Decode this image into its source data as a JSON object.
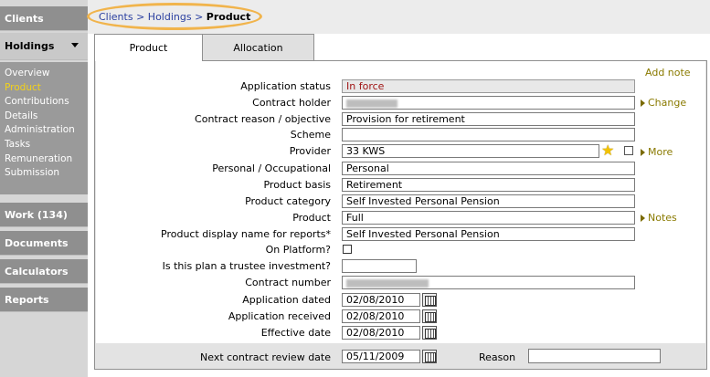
{
  "sidebar": {
    "clients": "Clients",
    "holdings": "Holdings",
    "subnav": [
      "Overview",
      "Product",
      "Contributions",
      "Details",
      "Administration",
      "Tasks",
      "Remuneration",
      "Submission"
    ],
    "work": "Work (134)",
    "documents": "Documents",
    "calculators": "Calculators",
    "reports": "Reports"
  },
  "breadcrumb": {
    "clients": "Clients",
    "holdings": "Holdings",
    "separator": " > ",
    "current": "Product"
  },
  "tabs": {
    "product": "Product",
    "allocation": "Allocation"
  },
  "actions": {
    "add_note": "Add note",
    "change": "Change",
    "more": "More",
    "notes": "Notes"
  },
  "form": {
    "application_status": {
      "label": "Application status",
      "value": "In force"
    },
    "contract_holder": {
      "label": "Contract holder",
      "value": ""
    },
    "contract_reason": {
      "label": "Contract reason / objective",
      "value": "Provision for retirement"
    },
    "scheme": {
      "label": "Scheme",
      "value": ""
    },
    "provider": {
      "label": "Provider",
      "value": "33 KWS"
    },
    "personal_occupational": {
      "label": "Personal / Occupational",
      "value": "Personal"
    },
    "product_basis": {
      "label": "Product basis",
      "value": "Retirement"
    },
    "product_category": {
      "label": "Product category",
      "value": "Self Invested Personal Pension"
    },
    "product": {
      "label": "Product",
      "value": "Full"
    },
    "display_name": {
      "label": "Product display name for reports*",
      "value": "Self Invested Personal Pension"
    },
    "on_platform": {
      "label": "On Platform?",
      "checked": false
    },
    "trustee_investment": {
      "label": "Is this plan a trustee investment?",
      "value": ""
    },
    "contract_number": {
      "label": "Contract number",
      "value": ""
    },
    "application_dated": {
      "label": "Application dated",
      "value": "02/08/2010"
    },
    "application_received": {
      "label": "Application received",
      "value": "02/08/2010"
    },
    "effective_date": {
      "label": "Effective date",
      "value": "02/08/2010"
    },
    "next_review": {
      "label": "Next contract review date",
      "value": "05/11/2009"
    },
    "reason": {
      "label": "Reason",
      "value": ""
    }
  },
  "icons": {
    "nav_caret": "caret-down-icon",
    "calendar": "calendar-icon",
    "star": "star-icon",
    "arrow": "arrow-right-icon"
  },
  "colors": {
    "sidebar": "#8f8f8f",
    "breadcrumb_highlight": "#f1b44c",
    "status_value": "#a01515",
    "action_link": "#8a7a00"
  }
}
